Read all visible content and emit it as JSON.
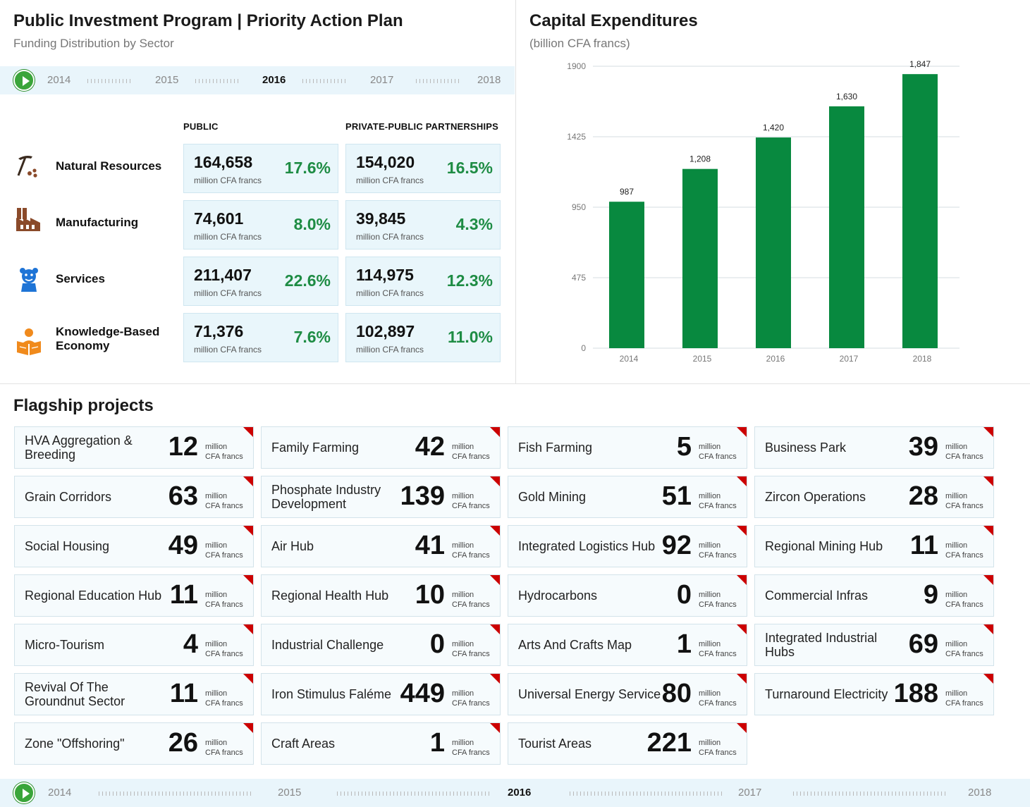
{
  "header": {
    "title": "Public Investment Program | Priority Action Plan",
    "subtitle": "Funding Distribution by Sector"
  },
  "timeline_top": {
    "years": [
      "2014",
      "2015",
      "2016",
      "2017",
      "2018"
    ],
    "active": "2016"
  },
  "timeline_bottom": {
    "years": [
      "2014",
      "2015",
      "2016",
      "2017",
      "2018"
    ],
    "active": "2016"
  },
  "table": {
    "col_public": "PUBLIC",
    "col_ppp": "PRIVATE-PUBLIC PARTNERSHIPS",
    "unit": "million CFA francs",
    "rows": [
      {
        "sector": "Natural Resources",
        "icon": "pickaxe-icon",
        "public_value": "164,658",
        "public_pct": "17.6%",
        "ppp_value": "154,020",
        "ppp_pct": "16.5%"
      },
      {
        "sector": "Manufacturing",
        "icon": "factory-icon",
        "public_value": "74,601",
        "public_pct": "8.0%",
        "ppp_value": "39,845",
        "ppp_pct": "4.3%"
      },
      {
        "sector": "Services",
        "icon": "bear-mascot-icon",
        "public_value": "211,407",
        "public_pct": "22.6%",
        "ppp_value": "114,975",
        "ppp_pct": "12.3%"
      },
      {
        "sector": "Knowledge-Based Economy",
        "icon": "reader-icon",
        "public_value": "71,376",
        "public_pct": "7.6%",
        "ppp_value": "102,897",
        "ppp_pct": "11.0%"
      }
    ]
  },
  "chart_title": "Capital Expenditures",
  "chart_subtitle": "(billion CFA francs)",
  "chart_data": {
    "type": "bar",
    "categories": [
      "2014",
      "2015",
      "2016",
      "2017",
      "2018"
    ],
    "values": [
      987,
      1208,
      1420,
      1630,
      1847
    ],
    "data_labels": [
      "987",
      "1,208",
      "1,420",
      "1,630",
      "1,847"
    ],
    "yticks": [
      0,
      475,
      950,
      1425,
      1900
    ],
    "ylim": [
      0,
      1900
    ],
    "grid": true,
    "bar_color": "#08893f"
  },
  "flagship": {
    "title": "Flagship projects",
    "unit_line1": "million",
    "unit_line2": "CFA francs",
    "projects": [
      {
        "name": "HVA Aggregation & Breeding",
        "value": "12"
      },
      {
        "name": "Family Farming",
        "value": "42"
      },
      {
        "name": "Fish Farming",
        "value": "5"
      },
      {
        "name": "Business Park",
        "value": "39"
      },
      {
        "name": "Grain Corridors",
        "value": "63"
      },
      {
        "name": "Phosphate Industry Development",
        "value": "139"
      },
      {
        "name": "Gold Mining",
        "value": "51"
      },
      {
        "name": "Zircon Operations",
        "value": "28"
      },
      {
        "name": "Social Housing",
        "value": "49"
      },
      {
        "name": "Air Hub",
        "value": "41"
      },
      {
        "name": "Integrated Logistics Hub",
        "value": "92"
      },
      {
        "name": "Regional Mining Hub",
        "value": "11"
      },
      {
        "name": "Regional Education Hub",
        "value": "11"
      },
      {
        "name": "Regional Health Hub",
        "value": "10"
      },
      {
        "name": "Hydrocarbons",
        "value": "0"
      },
      {
        "name": "Commercial Infras",
        "value": "9"
      },
      {
        "name": "Micro-Tourism",
        "value": "4"
      },
      {
        "name": "Industrial Challenge",
        "value": "0"
      },
      {
        "name": "Arts And Crafts Map",
        "value": "1"
      },
      {
        "name": "Integrated Industrial Hubs",
        "value": "69"
      },
      {
        "name": "Revival Of The Groundnut Sector",
        "value": "11"
      },
      {
        "name": "Iron Stimulus Faléme",
        "value": "449"
      },
      {
        "name": "Universal Energy Service",
        "value": "80"
      },
      {
        "name": "Turnaround Electricity",
        "value": "188"
      },
      {
        "name": "Zone \"Offshoring\"",
        "value": "26"
      },
      {
        "name": "Craft Areas",
        "value": "1"
      },
      {
        "name": "Tourist Areas",
        "value": "221"
      }
    ]
  }
}
